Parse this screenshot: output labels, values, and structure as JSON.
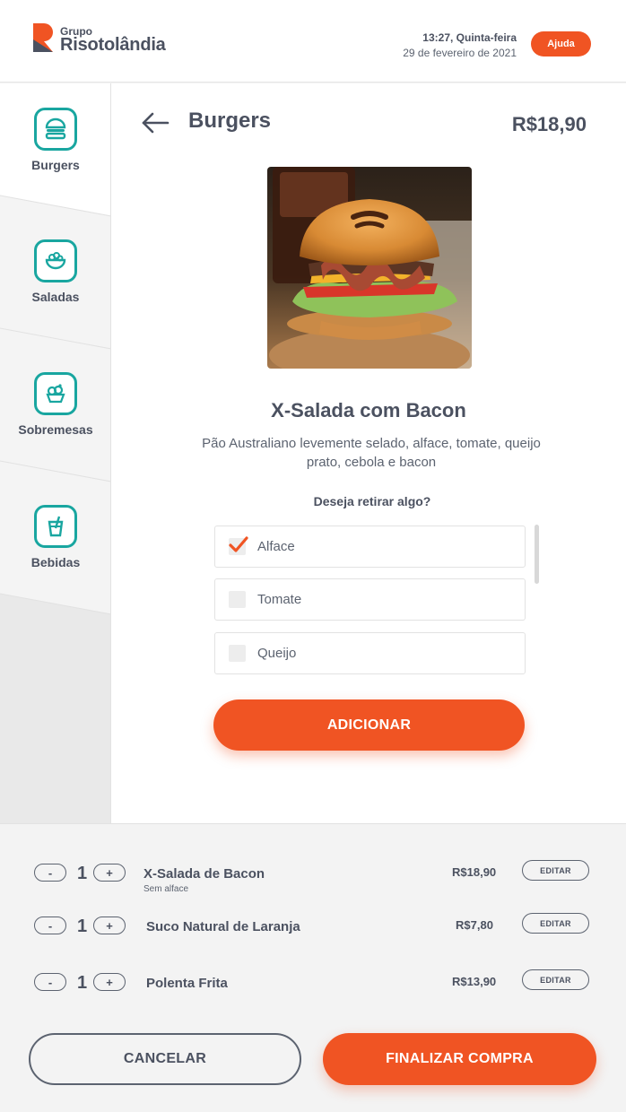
{
  "brand": {
    "small": "Grupo",
    "name": "Risotolândia",
    "accent": "#f05423",
    "icon_color": "#19a6a0"
  },
  "header": {
    "time": "13:27, Quinta-feira",
    "date": "29 de fevereiro de 2021",
    "help_label": "Ajuda"
  },
  "sidebar": {
    "items": [
      {
        "label": "Burgers",
        "icon": "burger-icon",
        "active": true
      },
      {
        "label": "Saladas",
        "icon": "salad-icon",
        "active": false
      },
      {
        "label": "Sobremesas",
        "icon": "dessert-icon",
        "active": false
      },
      {
        "label": "Bebidas",
        "icon": "drink-icon",
        "active": false
      }
    ]
  },
  "main": {
    "category_title": "Burgers",
    "price": "R$18,90",
    "product_name": "X-Salada com Bacon",
    "description": "Pão Australiano levemente selado, alface, tomate, queijo prato, cebola e bacon",
    "remove_question": "Deseja retirar algo?",
    "options": [
      {
        "label": "Alface",
        "checked": true
      },
      {
        "label": "Tomate",
        "checked": false
      },
      {
        "label": "Queijo",
        "checked": false
      }
    ],
    "add_label": "ADICIONAR"
  },
  "cart": {
    "items": [
      {
        "qty": "1",
        "name": "X-Salada de Bacon",
        "note": "Sem alface",
        "price": "R$18,90",
        "edit": "EDITAR"
      },
      {
        "qty": "1",
        "name": "Suco Natural de Laranja",
        "note": "",
        "price": "R$7,80",
        "edit": "EDITAR"
      },
      {
        "qty": "1",
        "name": "Polenta Frita",
        "note": "",
        "price": "R$13,90",
        "edit": "EDITAR"
      }
    ],
    "minus": "-",
    "plus": "+",
    "cancel_label": "CANCELAR",
    "finish_label": "FINALIZAR COMPRA"
  }
}
